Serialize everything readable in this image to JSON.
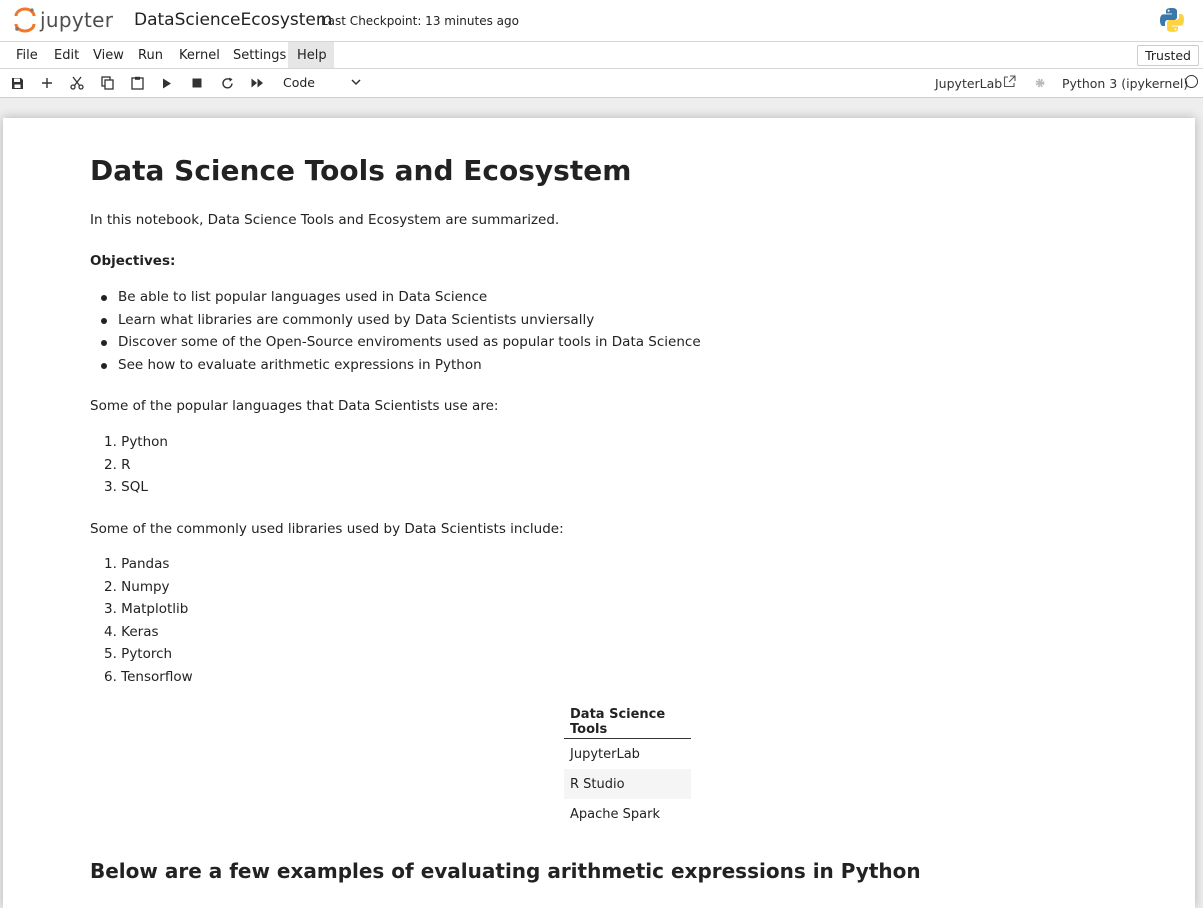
{
  "header": {
    "logo_text": "jupyter",
    "notebook_title": "DataScienceEcosystem",
    "checkpoint": "Last Checkpoint: 13 minutes ago"
  },
  "menubar": {
    "items": [
      "File",
      "Edit",
      "View",
      "Run",
      "Kernel",
      "Settings",
      "Help"
    ],
    "trusted": "Trusted"
  },
  "toolbar": {
    "cell_type": "Code",
    "jupyterlab_link": "JupyterLab",
    "kernel_name": "Python 3 (ipykernel)"
  },
  "notebook": {
    "title": "Data Science Tools and Ecosystem",
    "intro": "In this notebook, Data Science Tools and Ecosystem are summarized.",
    "objectives_label": "Objectives:",
    "objectives": [
      "Be able to list popular languages used in Data Science",
      "Learn what libraries are commonly used by Data Scientists unviersally",
      "Discover some of the Open-Source enviroments used as popular tools in Data Science",
      "See how to evaluate arithmetic expressions in Python"
    ],
    "languages_intro": "Some of the popular languages that Data Scientists use are:",
    "languages": [
      "1. Python",
      "2. R",
      "3. SQL"
    ],
    "libraries_intro": "Some of the commonly used libraries used by Data Scientists include:",
    "libraries": [
      "1. Pandas",
      "2. Numpy",
      "3. Matplotlib",
      "4. Keras",
      "5. Pytorch",
      "6. Tensorflow"
    ],
    "tools_table": {
      "header": "Data Science Tools",
      "rows": [
        "JupyterLab",
        "R Studio",
        "Apache Spark"
      ]
    },
    "examples_title": "Below are a few examples of evaluating arithmetic expressions in Python"
  }
}
